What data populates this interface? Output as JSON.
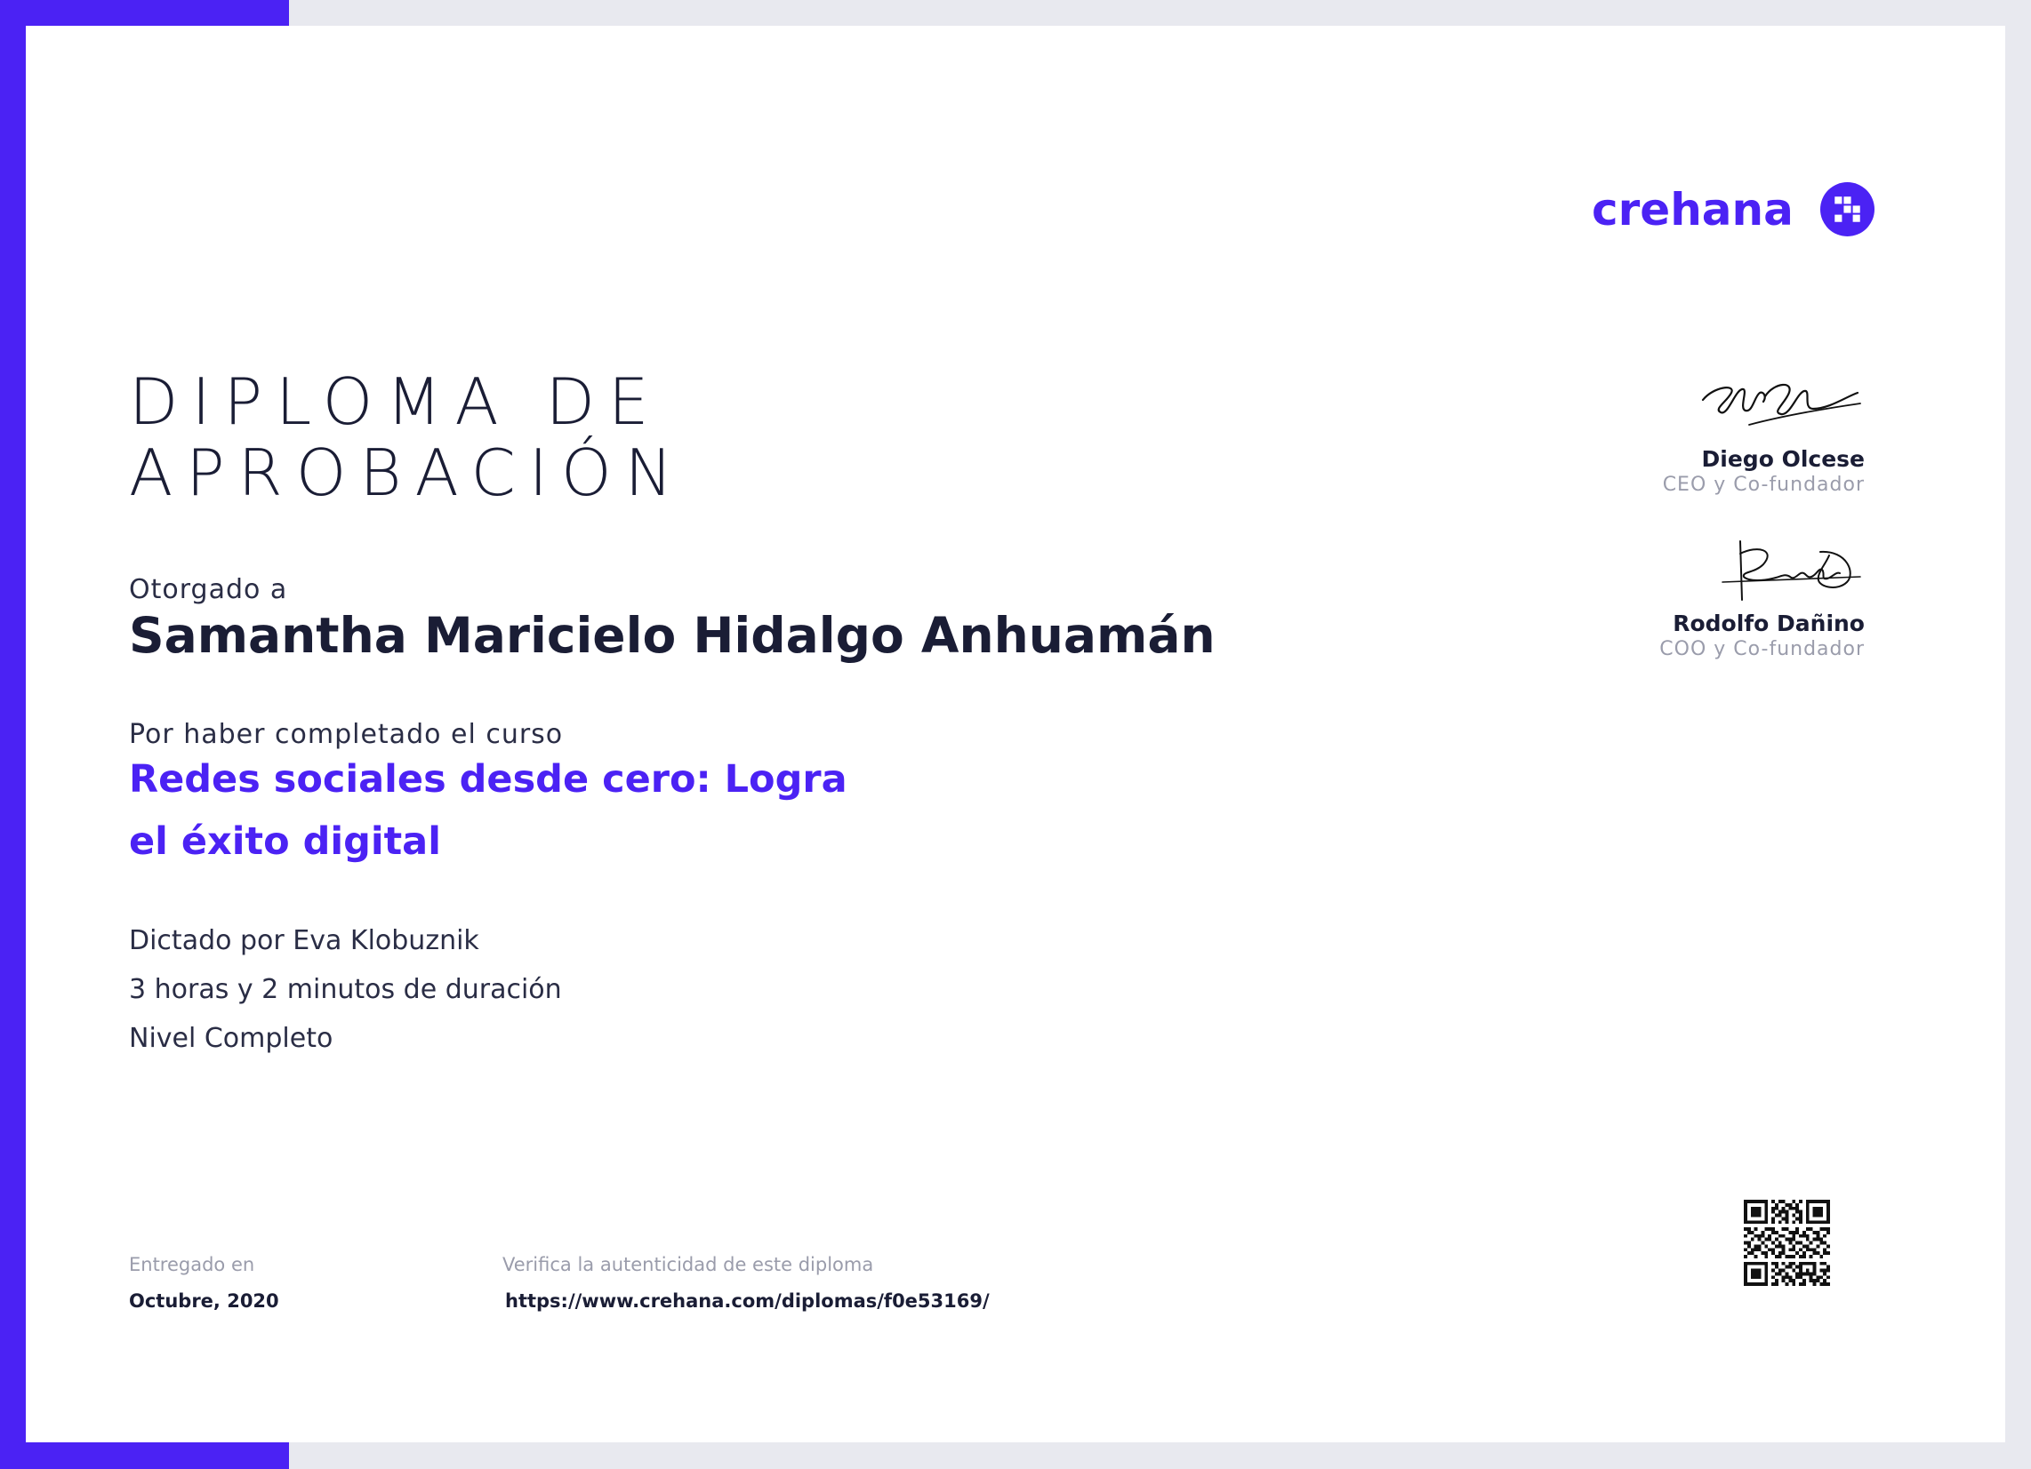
{
  "brand": {
    "name": "crehana",
    "logo_icon": "crehana-logo-icon",
    "accent_color": "#4b22f4"
  },
  "title": {
    "line1": "DIPLOMA DE",
    "line2": "APROBACIÓN"
  },
  "recipient": {
    "label": "Otorgado a",
    "name": "Samantha Maricielo Hidalgo Anhuamán"
  },
  "course": {
    "label": "Por haber completado el curso",
    "title": "Redes sociales desde cero: Logra el éxito digital",
    "instructor": "Dictado por Eva Klobuznik",
    "duration": "3 horas y 2 minutos de duración",
    "level": "Nivel Completo"
  },
  "signatures": [
    {
      "name": "Diego Olcese",
      "role": "CEO y Co-fundador",
      "icon": "signature-diego-olcese"
    },
    {
      "name": "Rodolfo Dañino",
      "role": "COO y Co-fundador",
      "icon": "signature-rodolfo-danino"
    }
  ],
  "footer": {
    "delivered_label": "Entregado en",
    "delivered_value": "Octubre, 2020",
    "verify_label": "Verifica la autenticidad de este diploma",
    "verify_url": "https://www.crehana.com/diplomas/f0e53169/",
    "qr_icon": "qr-code-icon"
  }
}
